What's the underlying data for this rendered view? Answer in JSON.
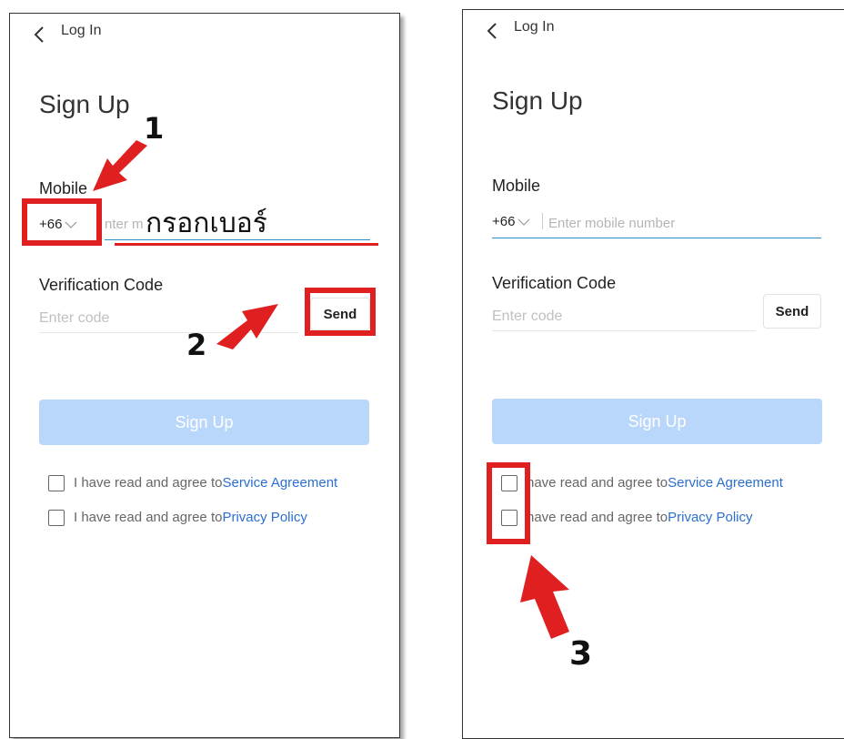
{
  "header": {
    "back_label": "Log In"
  },
  "title": "Sign Up",
  "mobile": {
    "label": "Mobile",
    "country_code": "+66",
    "placeholder": "Enter mobile number",
    "partial_visible": "nter m"
  },
  "verification": {
    "label": "Verification Code",
    "placeholder": "Enter code",
    "send_label": "Send"
  },
  "signup_button": "Sign Up",
  "agreements": [
    {
      "prefix": "I have read and agree to",
      "link": "Service Agreement"
    },
    {
      "prefix": "I have read and agree to",
      "link": "Privacy Policy"
    }
  ],
  "agreements_partial_prefix": "have read and agree to",
  "annotations": {
    "step1": "1",
    "step2": "2",
    "step3": "3",
    "thai_hint": "กรอกเบอร์",
    "color": "#e02020"
  },
  "colors": {
    "accent_link": "#2a6fd1",
    "signup_disabled": "#b9d7fa",
    "input_underline_active": "#2a8fc7"
  },
  "icons": {
    "back": "chevron-left-icon",
    "dropdown": "chevron-down-icon"
  }
}
